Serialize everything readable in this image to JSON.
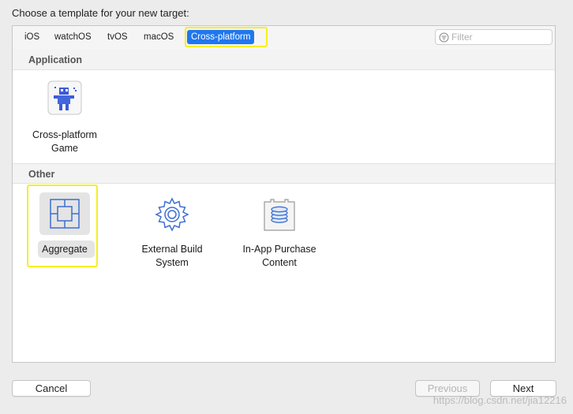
{
  "window": {
    "prompt": "Choose a template for your new target:"
  },
  "tabs": [
    {
      "label": "iOS"
    },
    {
      "label": "watchOS"
    },
    {
      "label": "tvOS"
    },
    {
      "label": "macOS"
    },
    {
      "label": "Cross-platform",
      "selected": true
    }
  ],
  "filter": {
    "placeholder": "Filter",
    "value": ""
  },
  "sections": {
    "application": {
      "title": "Application",
      "items": [
        {
          "line1": "Cross-platform",
          "line2": "Game",
          "icon": "game-robot-icon"
        }
      ]
    },
    "other": {
      "title": "Other",
      "items": [
        {
          "line1": "Aggregate",
          "line2": "",
          "icon": "aggregate-icon",
          "selected": true
        },
        {
          "line1": "External Build",
          "line2": "System",
          "icon": "gear-icon"
        },
        {
          "line1": "In-App Purchase",
          "line2": "Content",
          "icon": "in-app-purchase-icon"
        }
      ]
    }
  },
  "buttons": {
    "cancel": "Cancel",
    "previous": "Previous",
    "next": "Next"
  },
  "watermark": "https://blog.csdn.net/jia12216",
  "colors": {
    "accent": "#1f77f0",
    "highlight": "#f5ef22",
    "icon_blue": "#3c6fd1"
  }
}
